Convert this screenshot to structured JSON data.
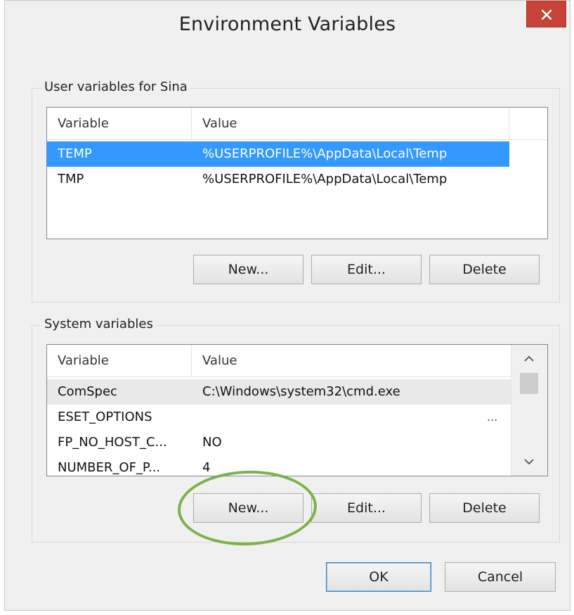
{
  "window": {
    "title": "Environment Variables"
  },
  "user_variables": {
    "group_label": "User variables for Sina",
    "columns": [
      "Variable",
      "Value"
    ],
    "rows": [
      {
        "variable": "TEMP",
        "value": "%USERPROFILE%\\AppData\\Local\\Temp",
        "selected": true
      },
      {
        "variable": "TMP",
        "value": "%USERPROFILE%\\AppData\\Local\\Temp",
        "selected": false
      }
    ],
    "buttons": {
      "new": "New...",
      "edit": "Edit...",
      "delete": "Delete"
    }
  },
  "system_variables": {
    "group_label": "System variables",
    "columns": [
      "Variable",
      "Value"
    ],
    "rows": [
      {
        "variable": "ComSpec",
        "value": "C:\\Windows\\system32\\cmd.exe",
        "selected": false
      },
      {
        "variable": "ESET_OPTIONS",
        "value": "",
        "trailing": "...",
        "selected": false
      },
      {
        "variable": "FP_NO_HOST_C...",
        "value": "NO",
        "selected": false
      },
      {
        "variable": "NUMBER_OF_P...",
        "value": "4",
        "selected": false
      }
    ],
    "buttons": {
      "new": "New...",
      "edit": "Edit...",
      "delete": "Delete"
    }
  },
  "footer": {
    "ok": "OK",
    "cancel": "Cancel"
  },
  "colors": {
    "selection": "#3399ff",
    "close_button": "#c7433a",
    "highlight_circle": "#7cb24a"
  },
  "icons": {
    "close": "close-icon",
    "scroll_up": "chevron-up-icon",
    "scroll_down": "chevron-down-icon"
  }
}
